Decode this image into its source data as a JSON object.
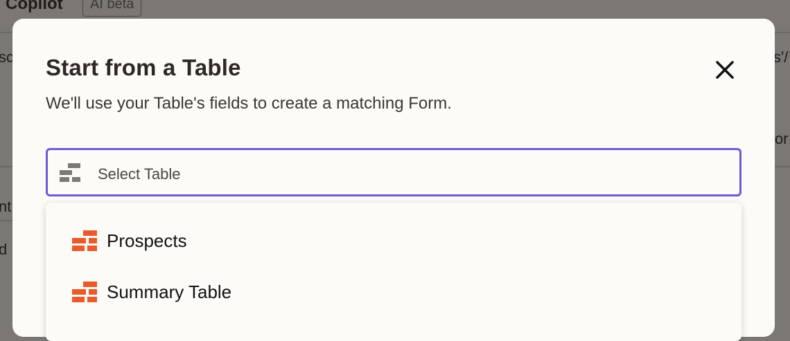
{
  "background": {
    "app_title": "Copilot",
    "badge": "AI beta",
    "fragments": [
      "sc",
      "s'/",
      "or",
      "nt",
      "d"
    ]
  },
  "modal": {
    "title": "Start from a Table",
    "subtitle": "We'll use your Table's fields to create a matching Form.",
    "close_icon": "close-icon",
    "select": {
      "placeholder": "Select Table",
      "icon": "table-icon",
      "focus_color": "#6e5ad4"
    },
    "options": [
      {
        "label": "Prospects",
        "icon": "table-icon"
      },
      {
        "label": "Summary Table",
        "icon": "table-icon"
      }
    ],
    "table_icon_color": "#ea5a2b"
  }
}
